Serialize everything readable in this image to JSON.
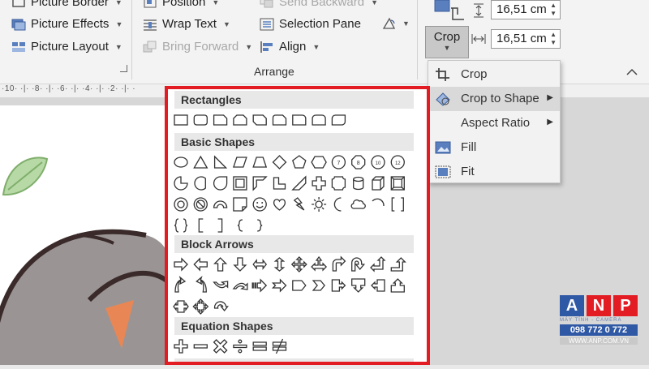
{
  "ribbon": {
    "picture_border": "Picture Border",
    "picture_effects": "Picture Effects",
    "picture_layout": "Picture Layout",
    "position": "Position",
    "wrap_text": "Wrap Text",
    "bring_forward": "Bring Forward",
    "send_backward": "Send Backward",
    "selection_pane": "Selection Pane",
    "align": "Align",
    "arrange_label": "Arrange",
    "height_value": "16,51 cm",
    "width_value": "16,51 cm",
    "crop_label": "Crop"
  },
  "ruler": {
    "marks": "·10· ·|· ·8· ·|· ·6· ·|· ·4· ·|· ·2· ·|· ·"
  },
  "crop_menu": {
    "items": [
      {
        "label": "Crop",
        "icon": "crop-icon"
      },
      {
        "label": "Crop to Shape",
        "icon": "crop-to-shape-icon",
        "submenu": true,
        "hover": true
      },
      {
        "label": "Aspect Ratio",
        "icon": "",
        "submenu": true
      },
      {
        "label": "Fill",
        "icon": "fill-icon"
      },
      {
        "label": "Fit",
        "icon": "fit-icon"
      }
    ]
  },
  "shapes_panel": {
    "categories": [
      {
        "name": "Rectangles",
        "shapes": [
          "rectangle",
          "rounded-rectangle",
          "snip-single-corner",
          "snip-same-side",
          "snip-diagonal",
          "snip-round-single",
          "round-single-corner",
          "round-same-side",
          "round-diagonal"
        ]
      },
      {
        "name": "Basic Shapes",
        "shapes": [
          "oval",
          "isosceles-triangle",
          "right-triangle",
          "parallelogram",
          "trapezoid",
          "diamond",
          "pentagon",
          "hexagon",
          "heptagon",
          "octagon",
          "decagon",
          "dodecagon",
          "pie",
          "chord",
          "teardrop",
          "frame",
          "half-frame",
          "l-shape",
          "diagonal-stripe",
          "cross",
          "plaque",
          "can",
          "cube",
          "bevel",
          "donut",
          "no-symbol",
          "block-arc",
          "folded-corner",
          "smiley-face",
          "heart",
          "lightning-bolt",
          "sun",
          "moon",
          "cloud",
          "arc",
          "double-bracket",
          "double-brace",
          "left-bracket",
          "right-bracket",
          "left-brace",
          "right-brace"
        ]
      },
      {
        "name": "Block Arrows",
        "shapes": [
          "right-arrow",
          "left-arrow",
          "up-arrow",
          "down-arrow",
          "left-right-arrow",
          "up-down-arrow",
          "quad-arrow",
          "left-right-up-arrow",
          "bent-arrow",
          "u-turn-arrow",
          "left-up-arrow",
          "bent-up-arrow",
          "curved-right-arrow",
          "curved-left-arrow",
          "curved-up-arrow",
          "curved-down-arrow",
          "striped-right-arrow",
          "notched-right-arrow",
          "pentagon-arrow",
          "chevron",
          "right-arrow-callout",
          "down-arrow-callout",
          "left-arrow-callout",
          "up-arrow-callout",
          "left-right-arrow-callout",
          "quad-arrow-callout",
          "circular-arrow"
        ]
      },
      {
        "name": "Equation Shapes",
        "shapes": [
          "plus",
          "minus",
          "multiply",
          "division",
          "equal",
          "not-equal"
        ]
      }
    ]
  },
  "logo": {
    "letters": [
      "A",
      "N",
      "P"
    ],
    "colors": [
      "#2f58a5",
      "#e31c23",
      "#e31c23"
    ],
    "tagline": "MÁY TÍNH - CAMERA",
    "phone": "098 772 0 772",
    "website": "WWW.ANP.COM.VN"
  },
  "accent": "#e31c23"
}
